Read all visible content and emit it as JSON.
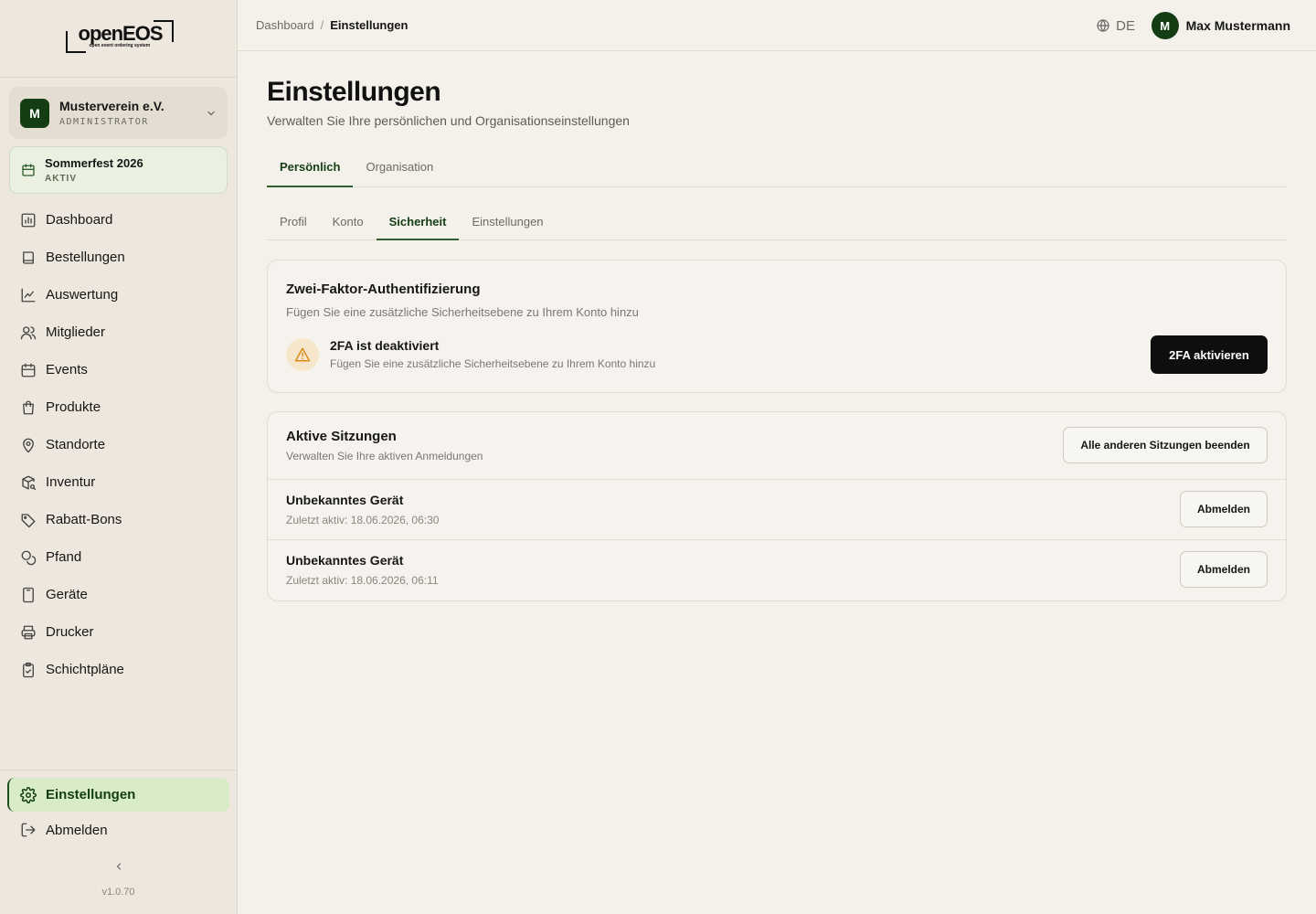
{
  "logo": {
    "name": "openEOS",
    "tagline": "open event ordering system"
  },
  "organization": {
    "avatar_letter": "M",
    "name": "Musterverein e.V.",
    "role": "ADMINISTRATOR"
  },
  "event": {
    "name": "Sommerfest 2026",
    "status": "AKTIV"
  },
  "nav": {
    "items": [
      {
        "label": "Dashboard",
        "icon": "chart-icon"
      },
      {
        "label": "Bestellungen",
        "icon": "book-icon"
      },
      {
        "label": "Auswertung",
        "icon": "line-chart-icon"
      },
      {
        "label": "Mitglieder",
        "icon": "users-icon"
      },
      {
        "label": "Events",
        "icon": "calendar-icon"
      },
      {
        "label": "Produkte",
        "icon": "shopping-bag-icon"
      },
      {
        "label": "Standorte",
        "icon": "map-pin-icon"
      },
      {
        "label": "Inventur",
        "icon": "package-search-icon"
      },
      {
        "label": "Rabatt-Bons",
        "icon": "tag-icon"
      },
      {
        "label": "Pfand",
        "icon": "coins-icon"
      },
      {
        "label": "Geräte",
        "icon": "tablet-icon"
      },
      {
        "label": "Drucker",
        "icon": "printer-icon"
      },
      {
        "label": "Schichtpläne",
        "icon": "clipboard-check-icon"
      }
    ],
    "settings_label": "Einstellungen",
    "logout_label": "Abmelden"
  },
  "version": "v1.0.70",
  "breadcrumb": {
    "parent": "Dashboard",
    "separator": "/",
    "current": "Einstellungen"
  },
  "header": {
    "language": "DE",
    "user_initial": "M",
    "user_name": "Max Mustermann"
  },
  "page": {
    "title": "Einstellungen",
    "subtitle": "Verwalten Sie Ihre persönlichen und Organisationseinstellungen"
  },
  "tabs_main": [
    "Persönlich",
    "Organisation"
  ],
  "tabs_sub": [
    "Profil",
    "Konto",
    "Sicherheit",
    "Einstellungen"
  ],
  "twofa": {
    "title": "Zwei-Faktor-Authentifizierung",
    "description": "Fügen Sie eine zusätzliche Sicherheitsebene zu Ihrem Konto hinzu",
    "status_title": "2FA ist deaktiviert",
    "status_description": "Fügen Sie eine zusätzliche Sicherheitsebene zu Ihrem Konto hinzu",
    "button": "2FA aktivieren"
  },
  "sessions": {
    "title": "Aktive Sitzungen",
    "description": "Verwalten Sie Ihre aktiven Anmeldungen",
    "end_all_button": "Alle anderen Sitzungen beenden",
    "rows": [
      {
        "device": "Unbekanntes Gerät",
        "last_active": "Zuletzt aktiv: 18.06.2026, 06:30",
        "button": "Abmelden"
      },
      {
        "device": "Unbekanntes Gerät",
        "last_active": "Zuletzt aktiv: 18.06.2026, 06:11",
        "button": "Abmelden"
      }
    ]
  },
  "colors": {
    "accent": "#143d14",
    "background": "#f4f1ea",
    "sidebar": "#ede7dd",
    "active_nav": "#d8ecc8",
    "warning": "#d98b1a"
  }
}
